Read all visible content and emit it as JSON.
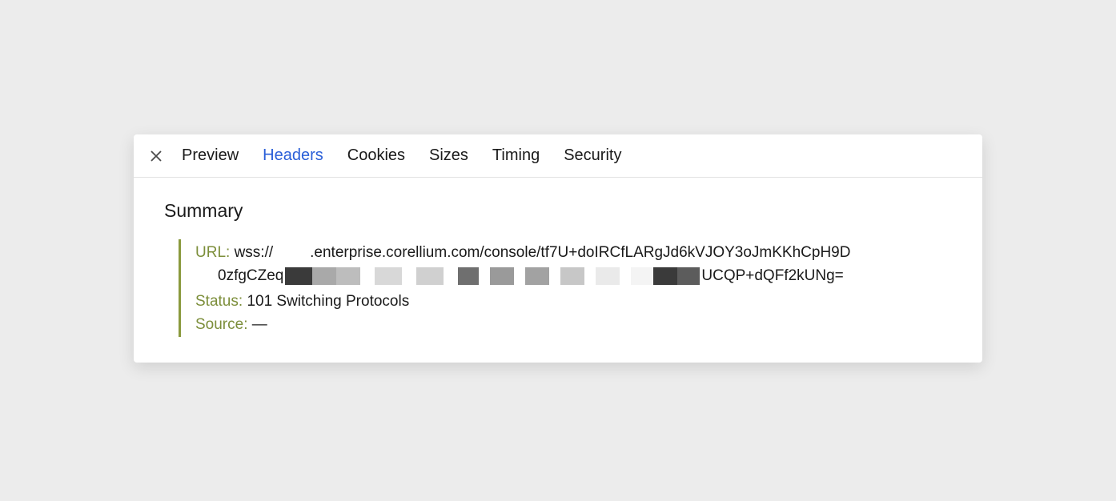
{
  "tabs": {
    "preview": "Preview",
    "headers": "Headers",
    "cookies": "Cookies",
    "sizes": "Sizes",
    "timing": "Timing",
    "security": "Security"
  },
  "section": {
    "title": "Summary"
  },
  "summary": {
    "url_label": "URL:",
    "url_prefix": "wss://",
    "url_host_suffix": ".enterprise.corellium.com/console/tf7U+doIRCfLARgJd6kVJOY3oJmKKhCpH9D",
    "url_line2_prefix": "0zfgCZeq",
    "url_line2_suffix": "UCQP+dQFf2kUNg=",
    "status_label": "Status:",
    "status_value": "101 Switching Protocols",
    "source_label": "Source:",
    "source_value": "—"
  }
}
